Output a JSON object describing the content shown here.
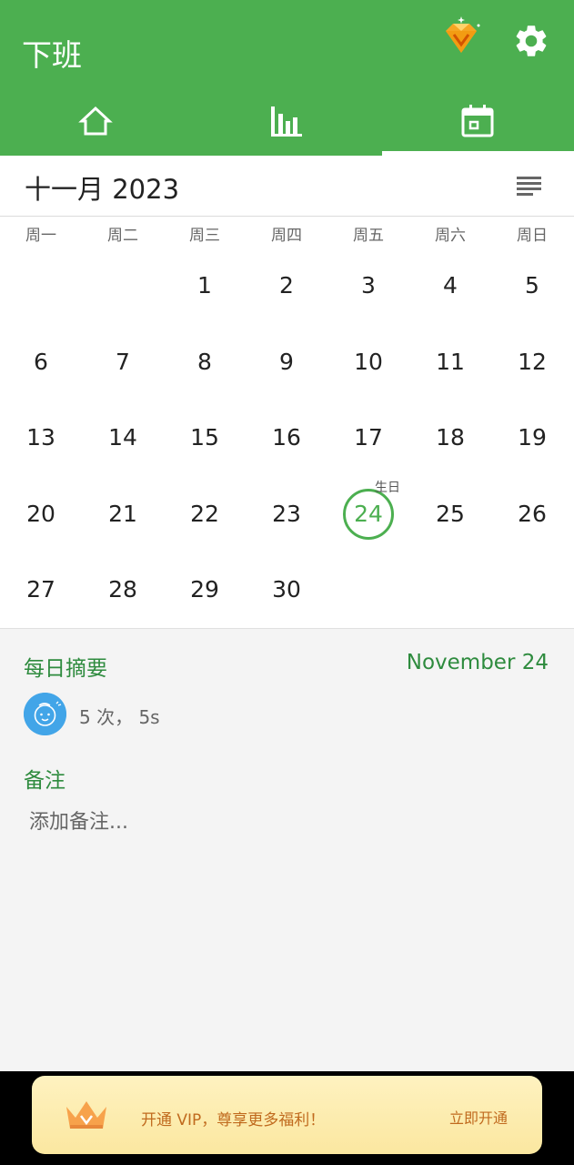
{
  "app": {
    "title": "下班"
  },
  "colors": {
    "primary": "#4caf50",
    "summary_text": "#2e8b3e",
    "vip_text": "#c06a1e"
  },
  "toolbar": {
    "icons": [
      "vip-diamond-icon",
      "gear-icon"
    ]
  },
  "tabs": [
    {
      "icon": "home-icon"
    },
    {
      "icon": "bar-chart-icon"
    },
    {
      "icon": "calendar-icon",
      "selected": true
    }
  ],
  "calendar": {
    "month_title": "十一月 2023",
    "weekdays": [
      "周一",
      "周二",
      "周三",
      "周四",
      "周五",
      "周六",
      "周日"
    ],
    "days": [
      "1",
      "2",
      "3",
      "4",
      "5",
      "6",
      "7",
      "8",
      "9",
      "10",
      "11",
      "12",
      "13",
      "14",
      "15",
      "16",
      "17",
      "18",
      "19",
      "20",
      "21",
      "22",
      "23",
      "24",
      "25",
      "26",
      "27",
      "28",
      "29",
      "30"
    ],
    "first_weekday_index": 2,
    "selected_day": "24",
    "selected_day_note": "生日"
  },
  "summary": {
    "title": "每日摘要",
    "date": "November 24",
    "stats": "5 次， 5s"
  },
  "notes": {
    "title": "备注",
    "placeholder": "添加备注..."
  },
  "vip_banner": {
    "text": "开通 VIP，尊享更多福利！",
    "action": "立即开通"
  }
}
